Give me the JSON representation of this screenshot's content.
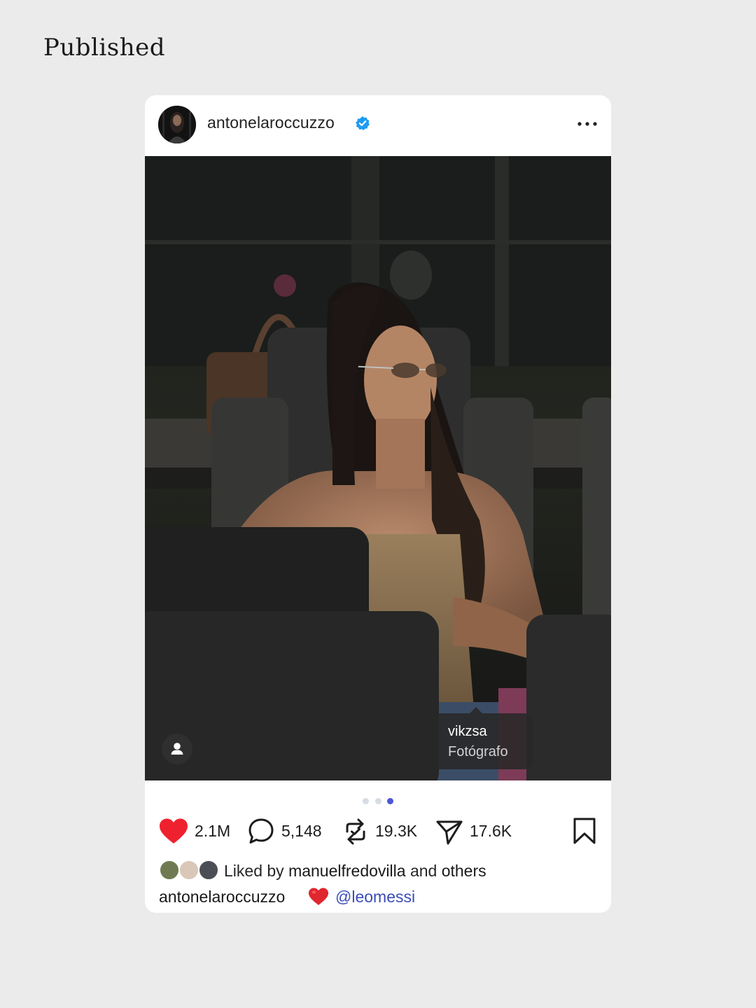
{
  "page": {
    "heading": "Published"
  },
  "post": {
    "username": "antonelaroccuzzo",
    "verified": true,
    "more_icon": "more-horizontal-icon",
    "photo_tag": {
      "name": "vikzsa",
      "role": "Fotógrafo"
    },
    "carousel": {
      "total": 3,
      "active_index": 2
    },
    "actions": {
      "likes": "2.1M",
      "comments": "5,148",
      "reposts": "19.3K",
      "shares": "17.6K"
    },
    "liked_by": {
      "prefix": "Liked by",
      "user": "manuelfredovilla",
      "connector": "and",
      "suffix": "others"
    },
    "caption": {
      "user": "antonelaroccuzzo",
      "emoji": "❤️",
      "mention": "@leomessi"
    }
  },
  "colors": {
    "page_bg": "#ebebeb",
    "card_bg": "#ffffff",
    "like_red": "#f0212f",
    "verified_blue": "#1d9bf0",
    "mention_blue": "#3a4cb8",
    "dot_active": "#4a56d6"
  }
}
